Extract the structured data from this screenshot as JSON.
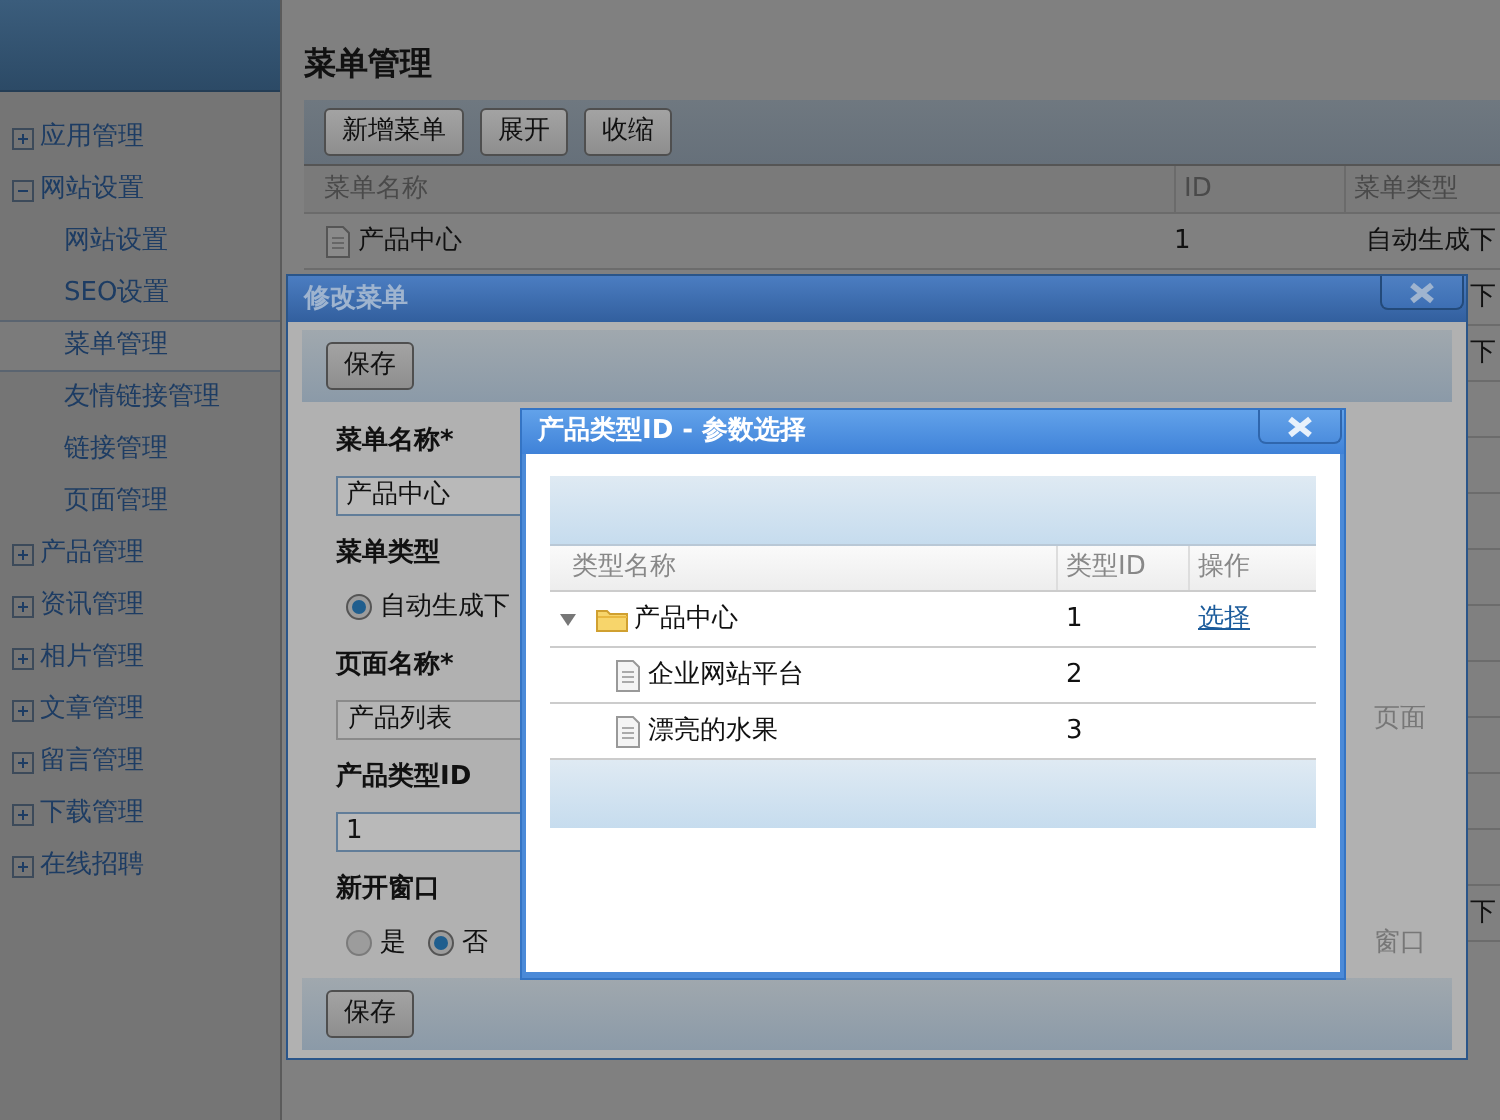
{
  "sidebar": {
    "items": [
      {
        "label": "应用管理",
        "expanded": false
      },
      {
        "label": "网站设置",
        "expanded": true,
        "children": [
          {
            "label": "网站设置",
            "selected": false
          },
          {
            "label": "SEO设置",
            "selected": false
          },
          {
            "label": "菜单管理",
            "selected": true
          },
          {
            "label": "友情链接管理",
            "selected": false
          },
          {
            "label": "链接管理",
            "selected": false
          },
          {
            "label": "页面管理",
            "selected": false
          }
        ]
      },
      {
        "label": "产品管理",
        "expanded": false
      },
      {
        "label": "资讯管理",
        "expanded": false
      },
      {
        "label": "相片管理",
        "expanded": false
      },
      {
        "label": "文章管理",
        "expanded": false
      },
      {
        "label": "留言管理",
        "expanded": false
      },
      {
        "label": "下载管理",
        "expanded": false
      },
      {
        "label": "在线招聘",
        "expanded": false
      }
    ]
  },
  "page": {
    "title": "菜单管理",
    "toolbar": [
      "新增菜单",
      "展开",
      "收缩"
    ],
    "table": {
      "columns": [
        "菜单名称",
        "ID",
        "菜单类型"
      ],
      "rows": [
        {
          "name": "产品中心",
          "id": "1",
          "type": "自动生成下"
        },
        {
          "type": "下"
        },
        {
          "type": "下"
        },
        {},
        {},
        {},
        {},
        {},
        {},
        {},
        {},
        {},
        {
          "type": "下"
        }
      ]
    }
  },
  "edit_dialog": {
    "title": "修改菜单",
    "toolbar_button": "保存",
    "fields": [
      {
        "kind": "text",
        "label": "菜单名称*",
        "value": "产品中心"
      },
      {
        "kind": "radio",
        "label": "菜单类型",
        "options": [
          {
            "label": "自动生成下",
            "selected": true
          }
        ]
      },
      {
        "kind": "select",
        "label": "页面名称*",
        "value": "产品列表",
        "suffix": "页面"
      },
      {
        "kind": "text",
        "label": "产品类型ID",
        "value": "1"
      },
      {
        "kind": "radio",
        "label": "新开窗口",
        "options": [
          {
            "label": "是",
            "selected": false
          },
          {
            "label": "否",
            "selected": true
          }
        ],
        "suffix": "窗口"
      }
    ],
    "footer_button": "保存"
  },
  "picker_dialog": {
    "title": "产品类型ID - 参数选择",
    "columns": [
      "类型名称",
      "类型ID",
      "操作"
    ],
    "rows": [
      {
        "kind": "folder",
        "name": "产品中心",
        "id": "1",
        "action": "选择",
        "expanded": true,
        "children": [
          {
            "kind": "file",
            "name": "企业网站平台",
            "id": "2"
          },
          {
            "kind": "file",
            "name": "漂亮的水果",
            "id": "3"
          }
        ]
      }
    ]
  }
}
